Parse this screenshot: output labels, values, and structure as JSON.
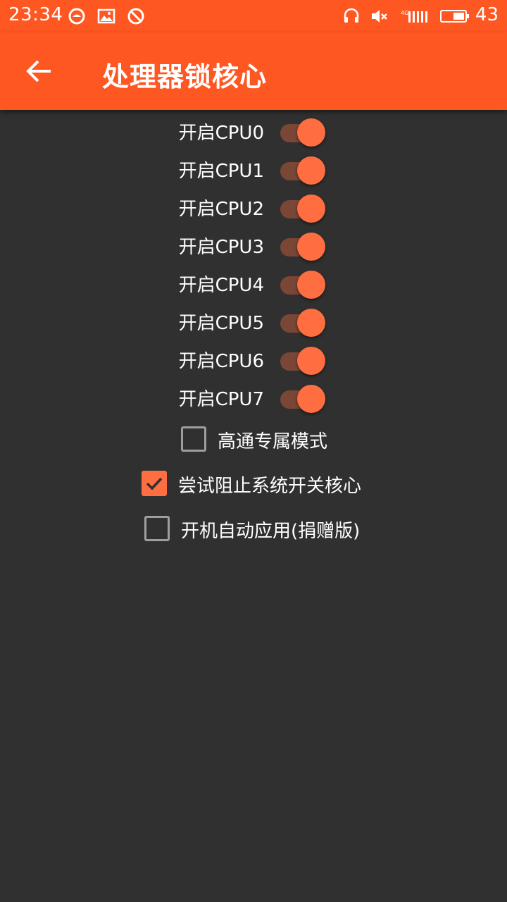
{
  "status_bar": {
    "time": "23:34",
    "battery_level": "43",
    "icons": [
      "message-circle-icon",
      "image-icon",
      "blocked-icon",
      "headset-icon",
      "volume-muted-icon",
      "signal-4g-icon",
      "battery-icon"
    ]
  },
  "app_bar": {
    "title": "处理器锁核心",
    "back_icon": "arrow-back-icon"
  },
  "cpu_switches": [
    {
      "label": "开启CPU0",
      "on": true
    },
    {
      "label": "开启CPU1",
      "on": true
    },
    {
      "label": "开启CPU2",
      "on": true
    },
    {
      "label": "开启CPU3",
      "on": true
    },
    {
      "label": "开启CPU4",
      "on": true
    },
    {
      "label": "开启CPU5",
      "on": true
    },
    {
      "label": "开启CPU6",
      "on": true
    },
    {
      "label": "开启CPU7",
      "on": true
    }
  ],
  "options": [
    {
      "label": "高通专属模式",
      "checked": false
    },
    {
      "label": "尝试阻止系统开关核心",
      "checked": true
    },
    {
      "label": "开机自动应用(捐赠版)",
      "checked": false
    }
  ],
  "colors": {
    "primary": "#ff5722",
    "accent": "#ff6e40",
    "background": "#303030",
    "switch_track_on": "#7a4636"
  }
}
